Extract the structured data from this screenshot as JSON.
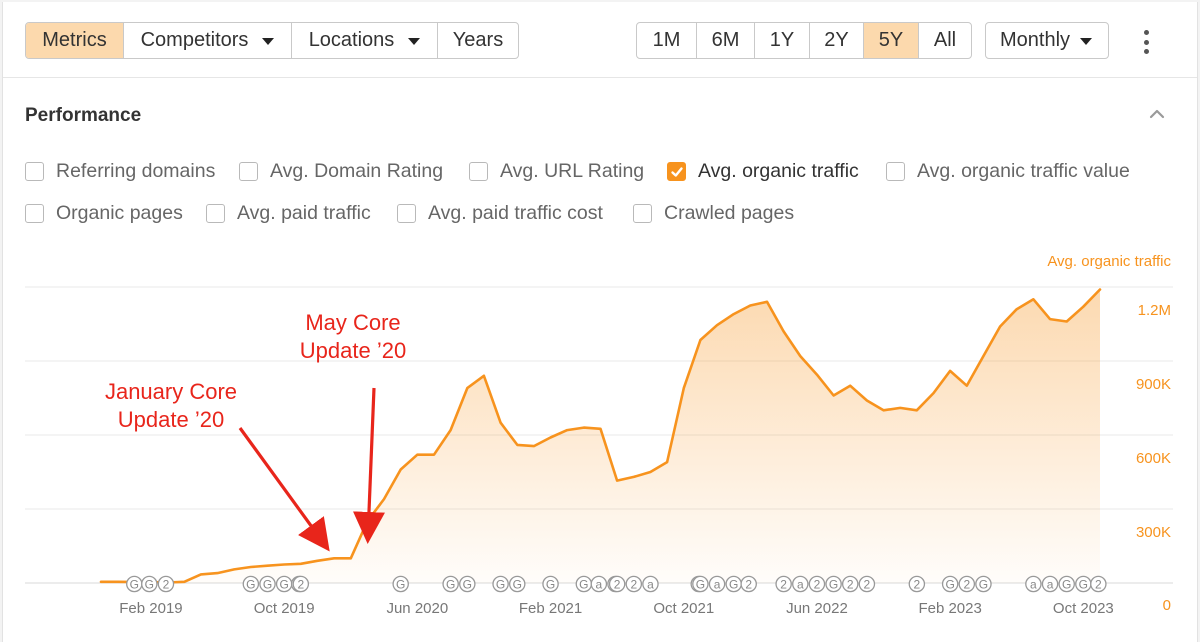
{
  "toolbar": {
    "view_tabs": [
      {
        "label": "Metrics",
        "active": true
      },
      {
        "label": "Competitors",
        "dropdown": true
      },
      {
        "label": "Locations",
        "dropdown": true
      },
      {
        "label": "Years"
      }
    ],
    "range_tabs": [
      {
        "label": "1M"
      },
      {
        "label": "6M"
      },
      {
        "label": "1Y"
      },
      {
        "label": "2Y"
      },
      {
        "label": "5Y",
        "active": true
      },
      {
        "label": "All"
      }
    ],
    "interval": "Monthly",
    "more_icon": "kebab-vertical-icon"
  },
  "panel": {
    "title": "Performance",
    "collapse_icon": "chevron-up-icon",
    "metrics": [
      {
        "label": "Referring domains",
        "checked": false
      },
      {
        "label": "Avg. Domain Rating",
        "checked": false
      },
      {
        "label": "Avg. URL Rating",
        "checked": false
      },
      {
        "label": "Avg. organic traffic",
        "checked": true
      },
      {
        "label": "Avg. organic traffic value",
        "checked": false
      },
      {
        "label": "Organic pages",
        "checked": false
      },
      {
        "label": "Avg. paid traffic",
        "checked": false
      },
      {
        "label": "Avg. paid traffic cost",
        "checked": false
      },
      {
        "label": "Crawled pages",
        "checked": false
      }
    ]
  },
  "colors": {
    "accent": "#f7931e",
    "active_tab": "#fcd9ad",
    "annotation": "#e8251b",
    "marker": "#999999"
  },
  "chart_data": {
    "type": "area",
    "series": [
      {
        "name": "Avg. organic traffic",
        "x": [
          "2018-11",
          "2018-12",
          "2019-01",
          "2019-02",
          "2019-03",
          "2019-04",
          "2019-05",
          "2019-06",
          "2019-07",
          "2019-08",
          "2019-09",
          "2019-10",
          "2019-11",
          "2019-12",
          "2020-01",
          "2020-02",
          "2020-03",
          "2020-04",
          "2020-05",
          "2020-06",
          "2020-07",
          "2020-08",
          "2020-09",
          "2020-10",
          "2020-11",
          "2020-12",
          "2021-01",
          "2021-02",
          "2021-03",
          "2021-04",
          "2021-05",
          "2021-06",
          "2021-07",
          "2021-08",
          "2021-09",
          "2021-10",
          "2021-11",
          "2021-12",
          "2022-01",
          "2022-02",
          "2022-03",
          "2022-04",
          "2022-05",
          "2022-06",
          "2022-07",
          "2022-08",
          "2022-09",
          "2022-10",
          "2022-11",
          "2022-12",
          "2023-01",
          "2023-02",
          "2023-03",
          "2023-04",
          "2023-05",
          "2023-06",
          "2023-07",
          "2023-08",
          "2023-09",
          "2023-10",
          "2023-11"
        ],
        "y": [
          5000,
          5000,
          4000,
          4000,
          2000,
          5000,
          35000,
          40000,
          55000,
          65000,
          70000,
          75000,
          78000,
          90000,
          100000,
          100000,
          250000,
          340000,
          460000,
          520000,
          520000,
          620000,
          790000,
          840000,
          650000,
          560000,
          555000,
          590000,
          620000,
          630000,
          625000,
          415000,
          430000,
          450000,
          490000,
          790000,
          985000,
          1045000,
          1090000,
          1125000,
          1140000,
          1020000,
          920000,
          845000,
          760000,
          800000,
          740000,
          700000,
          710000,
          700000,
          770000,
          860000,
          800000,
          920000,
          1040000,
          1110000,
          1150000,
          1070000,
          1060000,
          1120000,
          1190000
        ]
      }
    ],
    "x_ticks": [
      "Feb 2019",
      "Oct 2019",
      "Jun 2020",
      "Feb 2021",
      "Oct 2021",
      "Jun 2022",
      "Feb 2023",
      "Oct 2023"
    ],
    "y_ticks": [
      "0",
      "300K",
      "600K",
      "900K",
      "1.2M"
    ],
    "ylim": [
      0,
      1200000
    ],
    "y_axis_title": "Avg. organic traffic",
    "grid": true,
    "annotations": [
      {
        "text": [
          "January Core",
          "Update ’20"
        ],
        "target": "2020-01"
      },
      {
        "text": [
          "May Core",
          "Update ’20"
        ],
        "target": "2020-03"
      }
    ],
    "markers": [
      {
        "label": "G",
        "x": "2019-01",
        "offset": 0
      },
      {
        "label": "G",
        "x": "2019-01",
        "offset": 1
      },
      {
        "label": "2",
        "x": "2019-02",
        "offset": 1
      },
      {
        "label": "G",
        "x": "2019-08",
        "offset": 0
      },
      {
        "label": "G",
        "x": "2019-09",
        "offset": 0
      },
      {
        "label": "G",
        "x": "2019-10",
        "offset": 0
      },
      {
        "label": "G",
        "x": "2019-10",
        "offset": 1
      },
      {
        "label": "2",
        "x": "2019-11",
        "offset": 0
      },
      {
        "label": "G",
        "x": "2020-05",
        "offset": 0
      },
      {
        "label": "G",
        "x": "2020-08",
        "offset": 0
      },
      {
        "label": "G",
        "x": "2020-09",
        "offset": 0
      },
      {
        "label": "G",
        "x": "2020-11",
        "offset": 0
      },
      {
        "label": "G",
        "x": "2020-12",
        "offset": 0
      },
      {
        "label": "G",
        "x": "2021-02",
        "offset": 0
      },
      {
        "label": "G",
        "x": "2021-04",
        "offset": 0
      },
      {
        "label": "a",
        "x": "2021-04",
        "offset": 1
      },
      {
        "label": "5",
        "x": "2021-05",
        "offset": 1
      },
      {
        "label": "2",
        "x": "2021-06",
        "offset": 0
      },
      {
        "label": "2",
        "x": "2021-07",
        "offset": 0
      },
      {
        "label": "a",
        "x": "2021-08",
        "offset": 0
      },
      {
        "label": "3",
        "x": "2021-10",
        "offset": 1
      },
      {
        "label": "G",
        "x": "2021-11",
        "offset": 0
      },
      {
        "label": "a",
        "x": "2021-12",
        "offset": 0
      },
      {
        "label": "G",
        "x": "2022-01",
        "offset": 0
      },
      {
        "label": "2",
        "x": "2022-01",
        "offset": 1
      },
      {
        "label": "2",
        "x": "2022-04",
        "offset": 0
      },
      {
        "label": "a",
        "x": "2022-05",
        "offset": 0
      },
      {
        "label": "2",
        "x": "2022-06",
        "offset": 0
      },
      {
        "label": "G",
        "x": "2022-07",
        "offset": 0
      },
      {
        "label": "2",
        "x": "2022-08",
        "offset": 0
      },
      {
        "label": "2",
        "x": "2022-09",
        "offset": 0
      },
      {
        "label": "2",
        "x": "2022-12",
        "offset": 0
      },
      {
        "label": "G",
        "x": "2023-02",
        "offset": 0
      },
      {
        "label": "2",
        "x": "2023-03",
        "offset": 0
      },
      {
        "label": "G",
        "x": "2023-04",
        "offset": 0
      },
      {
        "label": "a",
        "x": "2023-07",
        "offset": 0
      },
      {
        "label": "a",
        "x": "2023-08",
        "offset": 0
      },
      {
        "label": "G",
        "x": "2023-09",
        "offset": 0
      },
      {
        "label": "G",
        "x": "2023-10",
        "offset": 0
      },
      {
        "label": "2",
        "x": "2023-10",
        "offset": 1
      }
    ]
  }
}
